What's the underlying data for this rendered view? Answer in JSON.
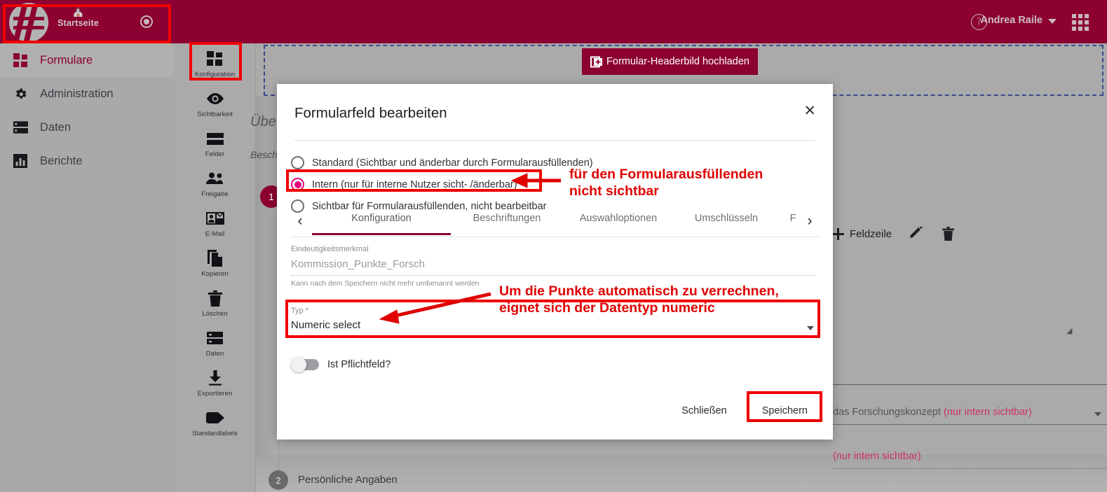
{
  "topbar": {
    "home_label": "Startseite",
    "user_name": "Andrea Raile",
    "help_icon": "help-circle-icon",
    "record_icon": "record-circle-icon",
    "apps_icon": "apps-grid-icon",
    "brand_color": "#8c0032"
  },
  "leftnav": {
    "items": [
      {
        "label": "Formulare",
        "icon": "grid-squares-icon",
        "active": true
      },
      {
        "label": "Administration",
        "icon": "gear-icon",
        "active": false
      },
      {
        "label": "Daten",
        "icon": "database-icon",
        "active": false
      },
      {
        "label": "Berichte",
        "icon": "bar-chart-icon",
        "active": false
      }
    ]
  },
  "rail": {
    "items": [
      {
        "label": "Konfiguration",
        "icon": "grid-squares-icon",
        "highlighted": true
      },
      {
        "label": "Sichtbarkeit",
        "icon": "eye-icon",
        "highlighted": false
      },
      {
        "label": "Felder",
        "icon": "rows-icon",
        "highlighted": false
      },
      {
        "label": "Freigabe",
        "icon": "people-icon",
        "highlighted": false
      },
      {
        "label": "E-Mail",
        "icon": "mail-card-icon",
        "highlighted": false
      },
      {
        "label": "Kopieren",
        "icon": "copy-icon",
        "highlighted": false
      },
      {
        "label": "Löschen",
        "icon": "trash-icon",
        "highlighted": false
      },
      {
        "label": "Daten",
        "icon": "server-icon",
        "highlighted": false
      },
      {
        "label": "Exportieren",
        "icon": "download-icon",
        "highlighted": false
      },
      {
        "label": "Standardlabels",
        "icon": "tag-icon",
        "highlighted": false
      }
    ]
  },
  "canvas": {
    "upload_button": "Formular-Headerbild hochladen",
    "title_partial": "Übe",
    "subtitle_partial": "Besch",
    "step1_number": "1",
    "step2_number": "2",
    "step2_label": "Persönliche Angaben",
    "row_add_label": "Feldzeile",
    "edit_icon": "pencil-icon",
    "delete_icon": "trash-icon",
    "select_value_partial": "das Forschungskonzept ",
    "select_value_pink": "(nur intern sichtbar)",
    "dotted_field_pink": "(nur intern sichtbar)"
  },
  "modal": {
    "title": "Formularfeld bearbeiten",
    "close_icon": "close-icon",
    "radios": [
      {
        "label": "Standard (Sichtbar und änderbar durch Formularausfüllenden)",
        "selected": false
      },
      {
        "label": "Intern (nur für interne Nutzer sicht- /änderbar)",
        "selected": true
      },
      {
        "label": "Sichtbar für Formularausfüllenden, nicht bearbeitbar",
        "selected": false
      }
    ],
    "tabs": [
      {
        "label": "Konfiguration",
        "selected": true
      },
      {
        "label": "Beschriftungen",
        "selected": false
      },
      {
        "label": "Auswahloptionen",
        "selected": false
      },
      {
        "label": "Umschlüsseln",
        "selected": false
      },
      {
        "label": "F",
        "selected": false
      }
    ],
    "tab_prev_icon": "chevron-left-icon",
    "tab_next_icon": "chevron-right-icon",
    "field_uid": {
      "label": "Eindeutigkeitsmerkmal",
      "value": "Kommission_Punkte_Forsch",
      "hint": "Kann nach dem Speichern nicht mehr umbenannt werden"
    },
    "field_typ": {
      "label": "Typ *",
      "value": "Numeric select",
      "dropdown_icon": "chevron-down-icon"
    },
    "toggle": {
      "label": "Ist Pflichtfeld?",
      "on": false
    },
    "close_button": "Schließen",
    "save_button": "Speichern"
  },
  "annotations": {
    "note1": "für den Formularausfüllenden\nnicht sichtbar",
    "note2": "Um die Punkte automatisch zu verrechnen,\neignet sich der Datentyp numeric",
    "color": "#e00000"
  }
}
